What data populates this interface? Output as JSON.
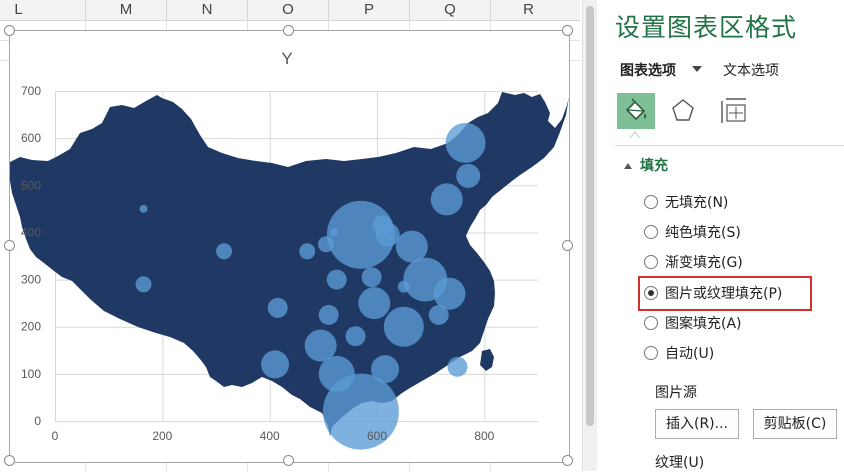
{
  "sheet": {
    "columns": [
      "L",
      "M",
      "N",
      "O",
      "P",
      "Q",
      "R"
    ]
  },
  "chart_data": {
    "type": "scatter",
    "title": "Y",
    "xlabel": "",
    "ylabel": "",
    "xlim": [
      0,
      900
    ],
    "ylim": [
      0,
      700
    ],
    "xticks": [
      "0",
      "200",
      "400",
      "600",
      "800"
    ],
    "yticks": [
      "0",
      "100",
      "200",
      "300",
      "400",
      "500",
      "600",
      "700"
    ],
    "bubble": true,
    "points": [
      {
        "x": 165,
        "y": 450,
        "r": 2
      },
      {
        "x": 315,
        "y": 360,
        "r": 4
      },
      {
        "x": 165,
        "y": 290,
        "r": 4
      },
      {
        "x": 415,
        "y": 240,
        "r": 5
      },
      {
        "x": 470,
        "y": 360,
        "r": 4
      },
      {
        "x": 505,
        "y": 375,
        "r": 4
      },
      {
        "x": 520,
        "y": 400,
        "r": 2
      },
      {
        "x": 570,
        "y": 395,
        "r": 17
      },
      {
        "x": 590,
        "y": 305,
        "r": 5
      },
      {
        "x": 525,
        "y": 300,
        "r": 5
      },
      {
        "x": 610,
        "y": 415,
        "r": 5
      },
      {
        "x": 620,
        "y": 395,
        "r": 6
      },
      {
        "x": 665,
        "y": 370,
        "r": 8
      },
      {
        "x": 690,
        "y": 300,
        "r": 11
      },
      {
        "x": 735,
        "y": 270,
        "r": 8
      },
      {
        "x": 650,
        "y": 285,
        "r": 3
      },
      {
        "x": 595,
        "y": 250,
        "r": 8
      },
      {
        "x": 715,
        "y": 225,
        "r": 5
      },
      {
        "x": 510,
        "y": 225,
        "r": 5
      },
      {
        "x": 560,
        "y": 180,
        "r": 5
      },
      {
        "x": 650,
        "y": 200,
        "r": 10
      },
      {
        "x": 495,
        "y": 160,
        "r": 8
      },
      {
        "x": 410,
        "y": 120,
        "r": 7
      },
      {
        "x": 525,
        "y": 100,
        "r": 9
      },
      {
        "x": 615,
        "y": 110,
        "r": 7
      },
      {
        "x": 750,
        "y": 115,
        "r": 5
      },
      {
        "x": 570,
        "y": 20,
        "r": 19
      },
      {
        "x": 770,
        "y": 520,
        "r": 6
      },
      {
        "x": 765,
        "y": 590,
        "r": 10
      },
      {
        "x": 730,
        "y": 470,
        "r": 8
      }
    ]
  },
  "pane": {
    "title": "设置图表区格式",
    "tab_chart_options": "图表选项",
    "tab_text_options": "文本选项",
    "section_fill": "填充",
    "fill_options": [
      {
        "label": "无填充(N)",
        "selected": false
      },
      {
        "label": "纯色填充(S)",
        "selected": false
      },
      {
        "label": "渐变填充(G)",
        "selected": false
      },
      {
        "label": "图片或纹理填充(P)",
        "selected": true
      },
      {
        "label": "图案填充(A)",
        "selected": false
      },
      {
        "label": "自动(U)",
        "selected": false
      }
    ],
    "picture_source_label": "图片源",
    "insert_button": "插入(R)...",
    "clipboard_button": "剪贴板(C)",
    "texture_label": "纹理(U)"
  },
  "colors": {
    "accent": "#217346",
    "map_fill": "#1f3864",
    "bubble_fill": "#5b9bd5",
    "highlight": "#d32f2f"
  }
}
